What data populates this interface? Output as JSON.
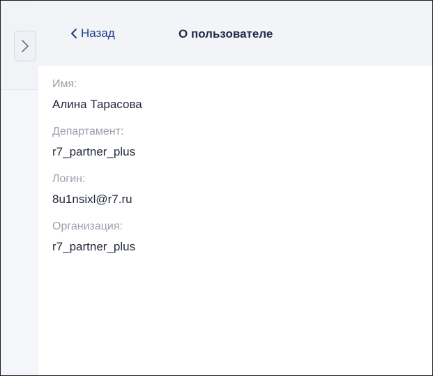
{
  "header": {
    "back_label": "Назад",
    "title": "О пользователе"
  },
  "fields": [
    {
      "label": "Имя:",
      "value": "Алина Тарасова"
    },
    {
      "label": "Департамент:",
      "value": "r7_partner_plus"
    },
    {
      "label": "Логин:",
      "value": "8u1nsixl@r7.ru"
    },
    {
      "label": "Организация:",
      "value": "r7_partner_plus"
    }
  ],
  "icons": {
    "expand": "chevron-right-icon",
    "back": "chevron-left-icon"
  },
  "colors": {
    "accent": "#1e3b8a",
    "label": "#9aa1ad",
    "value": "#222a38",
    "header_bg": "#f2f4f8"
  }
}
